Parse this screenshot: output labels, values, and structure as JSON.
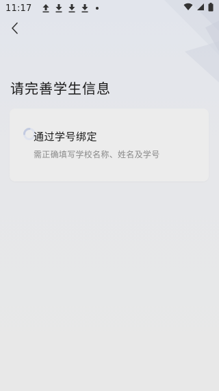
{
  "status_bar": {
    "time": "11:17",
    "notification_icons": [
      "upload-icon",
      "download-icon",
      "download-icon",
      "download-icon"
    ],
    "right_icons": [
      "wifi-icon",
      "signal-icon",
      "battery-icon"
    ]
  },
  "nav": {
    "back_icon": "chevron-left-icon"
  },
  "page": {
    "title": "请完善学生信息"
  },
  "card": {
    "title": "通过学号绑定",
    "subtitle": "需正确填写学校名称、姓名及学号"
  },
  "colors": {
    "background": "#e4e6ea",
    "card_background": "#ececec",
    "title_text": "#1a1a1a",
    "subtitle_text": "#8a8a8a"
  }
}
